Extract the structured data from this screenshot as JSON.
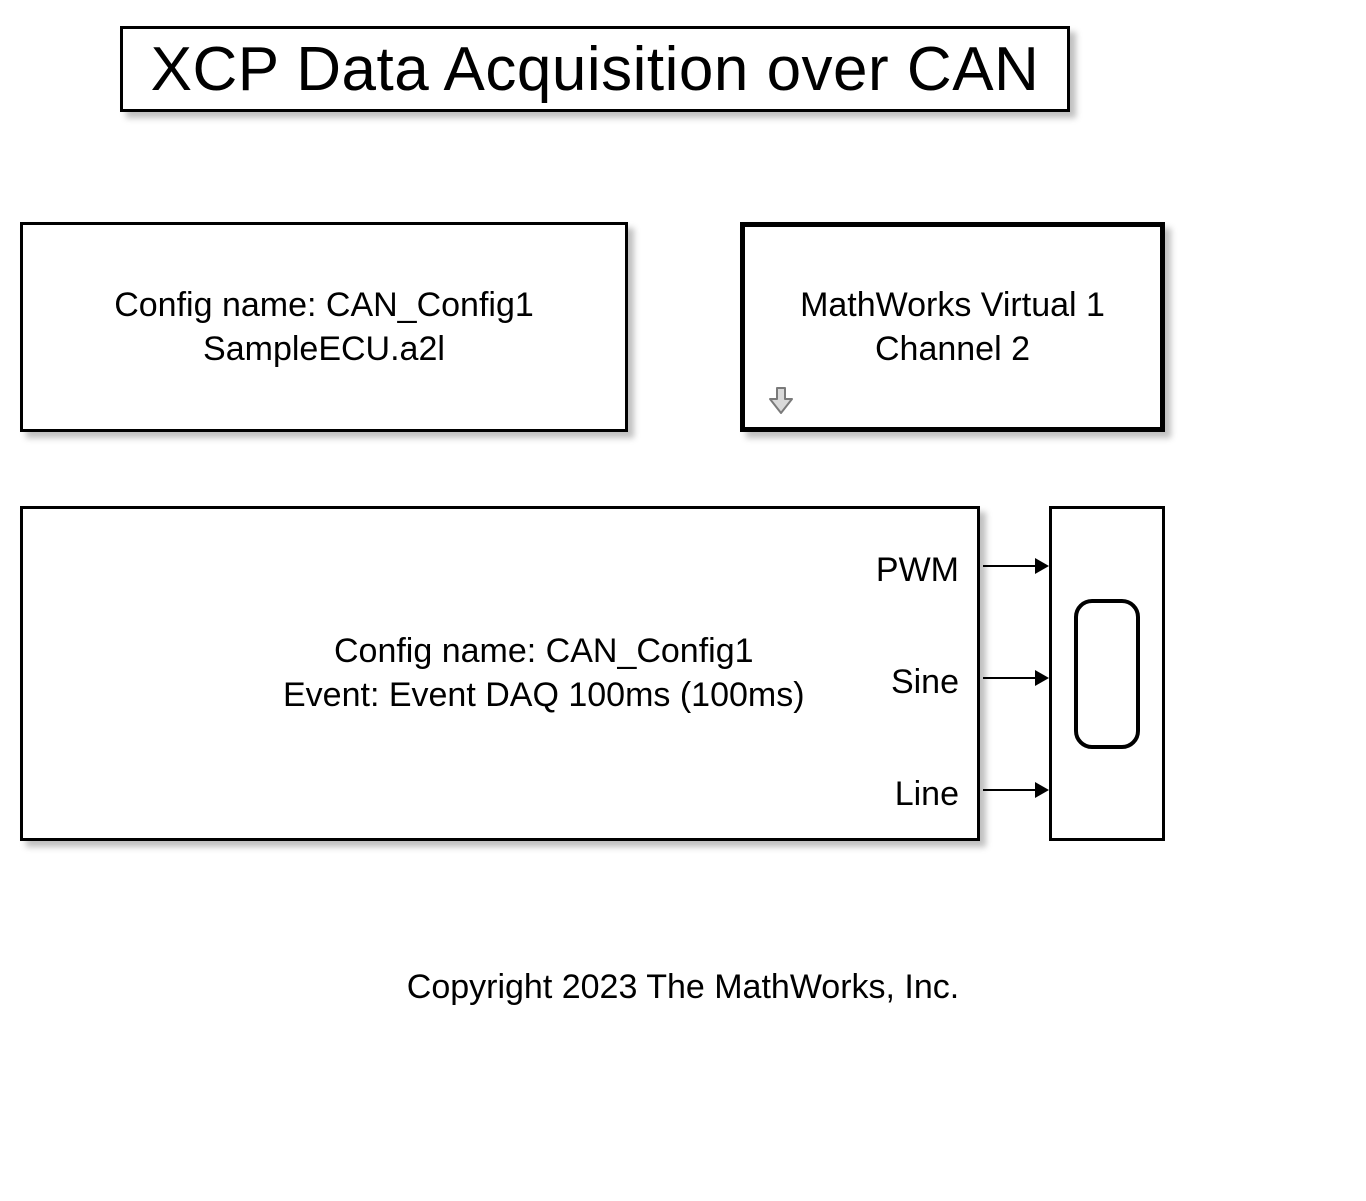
{
  "title": "XCP Data Acquisition over CAN",
  "config_block": {
    "line1": "Config name: CAN_Config1",
    "line2": "SampleECU.a2l"
  },
  "channel_block": {
    "line1": "MathWorks Virtual 1",
    "line2": "Channel 2"
  },
  "daq_block": {
    "line1": "Config name: CAN_Config1",
    "line2": "Event: Event DAQ 100ms (100ms)",
    "ports": [
      "PWM",
      "Sine",
      "Line"
    ]
  },
  "copyright": "Copyright 2023 The MathWorks, Inc."
}
